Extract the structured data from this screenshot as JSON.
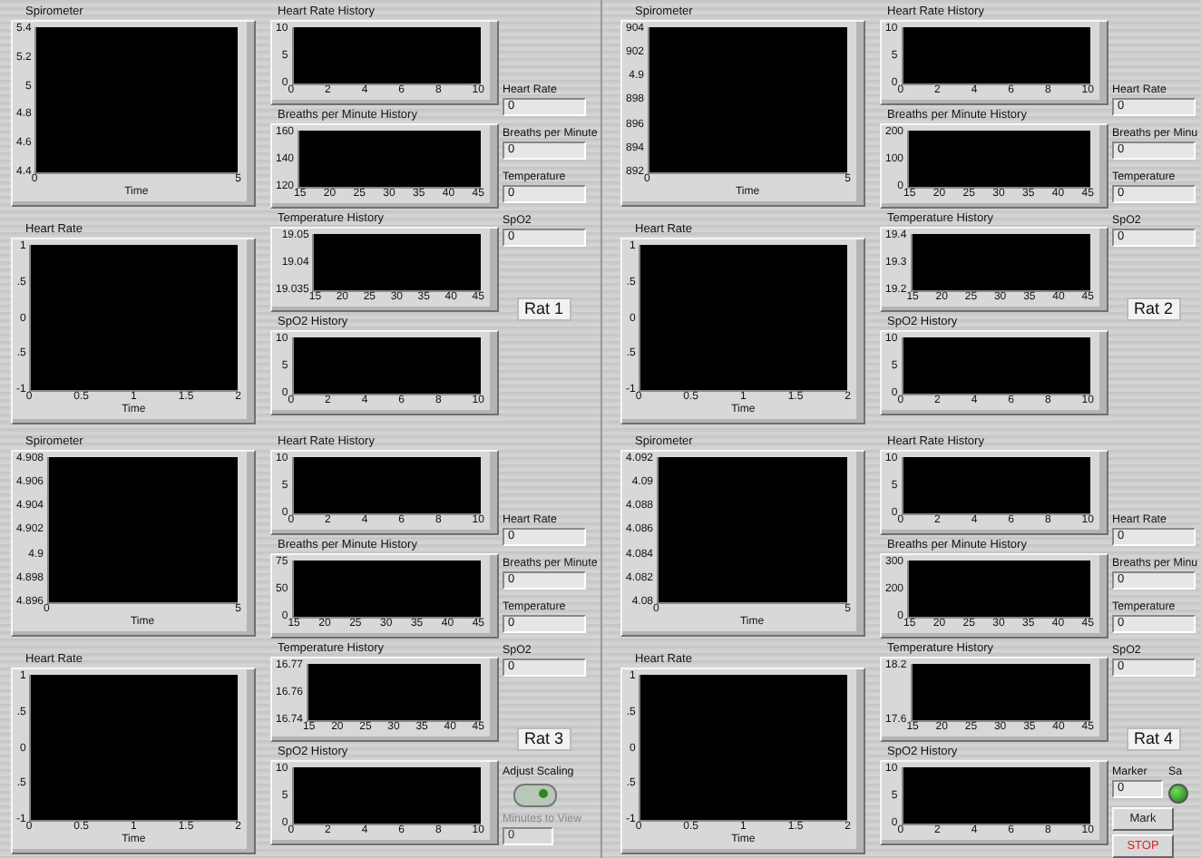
{
  "panels": [
    {
      "spirometer": {
        "title": "Spirometer",
        "y_ticks": [
          "5.4",
          "5.2",
          "5",
          "4.8",
          "4.6",
          "4.4"
        ],
        "x_ticks": [
          "0",
          "5"
        ],
        "x_label": "Time"
      },
      "heart_rate": {
        "title": "Heart Rate",
        "y_ticks": [
          "1",
          ".5",
          "0",
          ".5",
          "-1"
        ],
        "x_ticks": [
          "0",
          "0.5",
          "1",
          "1.5",
          "2"
        ],
        "x_label": "Time"
      },
      "histories": [
        {
          "title": "Heart Rate History",
          "y_ticks": [
            "10",
            "5",
            "0"
          ],
          "x_ticks": [
            "0",
            "2",
            "4",
            "6",
            "8",
            "10"
          ]
        },
        {
          "title": "Breaths per Minute History",
          "y_ticks": [
            "160",
            "140",
            "120"
          ],
          "x_ticks": [
            "15",
            "20",
            "25",
            "30",
            "35",
            "40",
            "45"
          ]
        },
        {
          "title": "Temperature History",
          "y_ticks": [
            "19.05",
            "19.04",
            "19.035"
          ],
          "x_ticks": [
            "15",
            "20",
            "25",
            "30",
            "35",
            "40",
            "45"
          ]
        },
        {
          "title": "SpO2 History",
          "y_ticks": [
            "10",
            "5",
            "0"
          ],
          "x_ticks": [
            "0",
            "2",
            "4",
            "6",
            "8",
            "10"
          ]
        }
      ],
      "indicators": [
        {
          "label": "Heart Rate",
          "value": "0"
        },
        {
          "label": "Breaths per Minute",
          "value": "0"
        },
        {
          "label": "Temperature",
          "value": "0"
        },
        {
          "label": "SpO2",
          "value": "0"
        }
      ],
      "rat_label": "Rat 1"
    },
    {
      "spirometer": {
        "title": "Spirometer",
        "y_ticks": [
          "904",
          "902",
          "4.9",
          "898",
          "896",
          "894",
          "892"
        ],
        "x_ticks": [
          "0",
          "5"
        ],
        "x_label": "Time"
      },
      "heart_rate": {
        "title": "Heart Rate",
        "y_ticks": [
          "1",
          ".5",
          "0",
          ".5",
          "-1"
        ],
        "x_ticks": [
          "0",
          "0.5",
          "1",
          "1.5",
          "2"
        ],
        "x_label": "Time"
      },
      "histories": [
        {
          "title": "Heart Rate History",
          "y_ticks": [
            "10",
            "5",
            "0"
          ],
          "x_ticks": [
            "0",
            "2",
            "4",
            "6",
            "8",
            "10"
          ]
        },
        {
          "title": "Breaths per Minute History",
          "y_ticks": [
            "200",
            "100",
            "0"
          ],
          "x_ticks": [
            "15",
            "20",
            "25",
            "30",
            "35",
            "40",
            "45"
          ]
        },
        {
          "title": "Temperature History",
          "y_ticks": [
            "19.4",
            "19.3",
            "19.2"
          ],
          "x_ticks": [
            "15",
            "20",
            "25",
            "30",
            "35",
            "40",
            "45"
          ]
        },
        {
          "title": "SpO2 History",
          "y_ticks": [
            "10",
            "5",
            "0"
          ],
          "x_ticks": [
            "0",
            "2",
            "4",
            "6",
            "8",
            "10"
          ]
        }
      ],
      "indicators": [
        {
          "label": "Heart Rate",
          "value": "0"
        },
        {
          "label": "Breaths per Minu",
          "value": "0"
        },
        {
          "label": "Temperature",
          "value": "0"
        },
        {
          "label": "SpO2",
          "value": "0"
        }
      ],
      "rat_label": "Rat 2"
    },
    {
      "spirometer": {
        "title": "Spirometer",
        "y_ticks": [
          "4.908",
          "4.906",
          "4.904",
          "4.902",
          "4.9",
          "4.898",
          "4.896"
        ],
        "x_ticks": [
          "0",
          "5"
        ],
        "x_label": "Time"
      },
      "heart_rate": {
        "title": "Heart Rate",
        "y_ticks": [
          "1",
          ".5",
          "0",
          ".5",
          "-1"
        ],
        "x_ticks": [
          "0",
          "0.5",
          "1",
          "1.5",
          "2"
        ],
        "x_label": "Time"
      },
      "histories": [
        {
          "title": "Heart Rate History",
          "y_ticks": [
            "10",
            "5",
            "0"
          ],
          "x_ticks": [
            "0",
            "2",
            "4",
            "6",
            "8",
            "10"
          ]
        },
        {
          "title": "Breaths per Minute History",
          "y_ticks": [
            "75",
            "50",
            "0"
          ],
          "x_ticks": [
            "15",
            "20",
            "25",
            "30",
            "35",
            "40",
            "45"
          ]
        },
        {
          "title": "Temperature History",
          "y_ticks": [
            "16.77",
            "16.76",
            "16.74"
          ],
          "x_ticks": [
            "15",
            "20",
            "25",
            "30",
            "35",
            "40",
            "45"
          ]
        },
        {
          "title": "SpO2 History",
          "y_ticks": [
            "10",
            "5",
            "0"
          ],
          "x_ticks": [
            "0",
            "2",
            "4",
            "6",
            "8",
            "10"
          ]
        }
      ],
      "indicators": [
        {
          "label": "Heart Rate",
          "value": "0"
        },
        {
          "label": "Breaths per Minute",
          "value": "0"
        },
        {
          "label": "Temperature",
          "value": "0"
        },
        {
          "label": "SpO2",
          "value": "0"
        }
      ],
      "rat_label": "Rat 3",
      "extras": [
        {
          "kind": "toggle",
          "label": "Adjust Scaling",
          "on": true
        },
        {
          "kind": "field",
          "label": "Minutes to View",
          "value": "0",
          "disabled": true
        }
      ]
    },
    {
      "spirometer": {
        "title": "Spirometer",
        "y_ticks": [
          "4.092",
          "4.09",
          "4.088",
          "4.086",
          "4.084",
          "4.082",
          "4.08"
        ],
        "x_ticks": [
          "0",
          "5"
        ],
        "x_label": "Time"
      },
      "heart_rate": {
        "title": "Heart Rate",
        "y_ticks": [
          "1",
          ".5",
          "0",
          ".5",
          "-1"
        ],
        "x_ticks": [
          "0",
          "0.5",
          "1",
          "1.5",
          "2"
        ],
        "x_label": "Time"
      },
      "histories": [
        {
          "title": "Heart Rate History",
          "y_ticks": [
            "10",
            "5",
            "0"
          ],
          "x_ticks": [
            "0",
            "2",
            "4",
            "6",
            "8",
            "10"
          ]
        },
        {
          "title": "Breaths per Minute History",
          "y_ticks": [
            "300",
            "200",
            "0"
          ],
          "x_ticks": [
            "15",
            "20",
            "25",
            "30",
            "35",
            "40",
            "45"
          ]
        },
        {
          "title": "Temperature History",
          "y_ticks": [
            "18.2",
            "17.6"
          ],
          "x_ticks": [
            "15",
            "20",
            "25",
            "30",
            "35",
            "40",
            "45"
          ]
        },
        {
          "title": "SpO2 History",
          "y_ticks": [
            "10",
            "5",
            "0"
          ],
          "x_ticks": [
            "0",
            "2",
            "4",
            "6",
            "8",
            "10"
          ]
        }
      ],
      "indicators": [
        {
          "label": "Heart Rate",
          "value": "0"
        },
        {
          "label": "Breaths per Minu",
          "value": "0"
        },
        {
          "label": "Temperature",
          "value": "0"
        },
        {
          "label": "SpO2",
          "value": "0"
        }
      ],
      "rat_label": "Rat 4",
      "extras": [
        {
          "kind": "field",
          "label": "Marker",
          "value": "0",
          "disabled": false
        },
        {
          "kind": "led",
          "label": "Sa",
          "on": true
        },
        {
          "kind": "button",
          "label": "Mark"
        },
        {
          "kind": "stop_button",
          "label": "STOP"
        }
      ]
    }
  ]
}
